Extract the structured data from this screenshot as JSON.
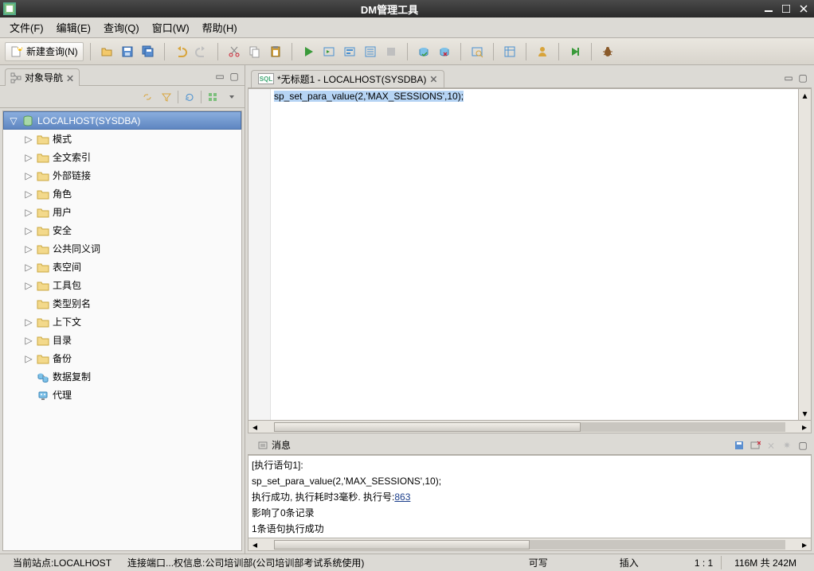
{
  "window": {
    "title": "DM管理工具"
  },
  "menus": {
    "file": "文件(F)",
    "edit": "编辑(E)",
    "query": "查询(Q)",
    "window": "窗口(W)",
    "help": "帮助(H)"
  },
  "toolbar": {
    "new_query": "新建查询(N)"
  },
  "left_panel": {
    "title": "对象导航",
    "root": "LOCALHOST(SYSDBA)",
    "items": [
      {
        "label": "模式",
        "expandable": true,
        "icon": "folder"
      },
      {
        "label": "全文索引",
        "expandable": true,
        "icon": "folder"
      },
      {
        "label": "外部链接",
        "expandable": true,
        "icon": "folder"
      },
      {
        "label": "角色",
        "expandable": true,
        "icon": "folder"
      },
      {
        "label": "用户",
        "expandable": true,
        "icon": "folder"
      },
      {
        "label": "安全",
        "expandable": true,
        "icon": "folder"
      },
      {
        "label": "公共同义词",
        "expandable": true,
        "icon": "folder"
      },
      {
        "label": "表空间",
        "expandable": true,
        "icon": "folder"
      },
      {
        "label": "工具包",
        "expandable": true,
        "icon": "folder"
      },
      {
        "label": "类型别名",
        "expandable": false,
        "icon": "folder"
      },
      {
        "label": "上下文",
        "expandable": true,
        "icon": "folder"
      },
      {
        "label": "目录",
        "expandable": true,
        "icon": "folder"
      },
      {
        "label": "备份",
        "expandable": true,
        "icon": "folder"
      },
      {
        "label": "数据复制",
        "expandable": false,
        "icon": "replication"
      },
      {
        "label": "代理",
        "expandable": false,
        "icon": "agent"
      }
    ]
  },
  "editor": {
    "tab_title": "*无标题1 - LOCALHOST(SYSDBA)",
    "sql_icon_label": "SQL",
    "content": "sp_set_para_value(2,'MAX_SESSIONS',10);"
  },
  "messages": {
    "title": "消息",
    "line1": "[执行语句1]:",
    "line2": "sp_set_para_value(2,'MAX_SESSIONS',10);",
    "line3_prefix": "执行成功, 执行耗时3毫秒. 执行号:",
    "line3_link": "863",
    "line4": "影响了0条记录",
    "line_blank": " ",
    "line5": "1条语句执行成功"
  },
  "status": {
    "site": "当前站点:LOCALHOST",
    "conn": "连接端口...权信息:公司培训部(公司培训部考试系统使用)",
    "rw": "可写",
    "ins": "插入",
    "pos": "1 : 1",
    "mem": "116M 共 242M"
  }
}
